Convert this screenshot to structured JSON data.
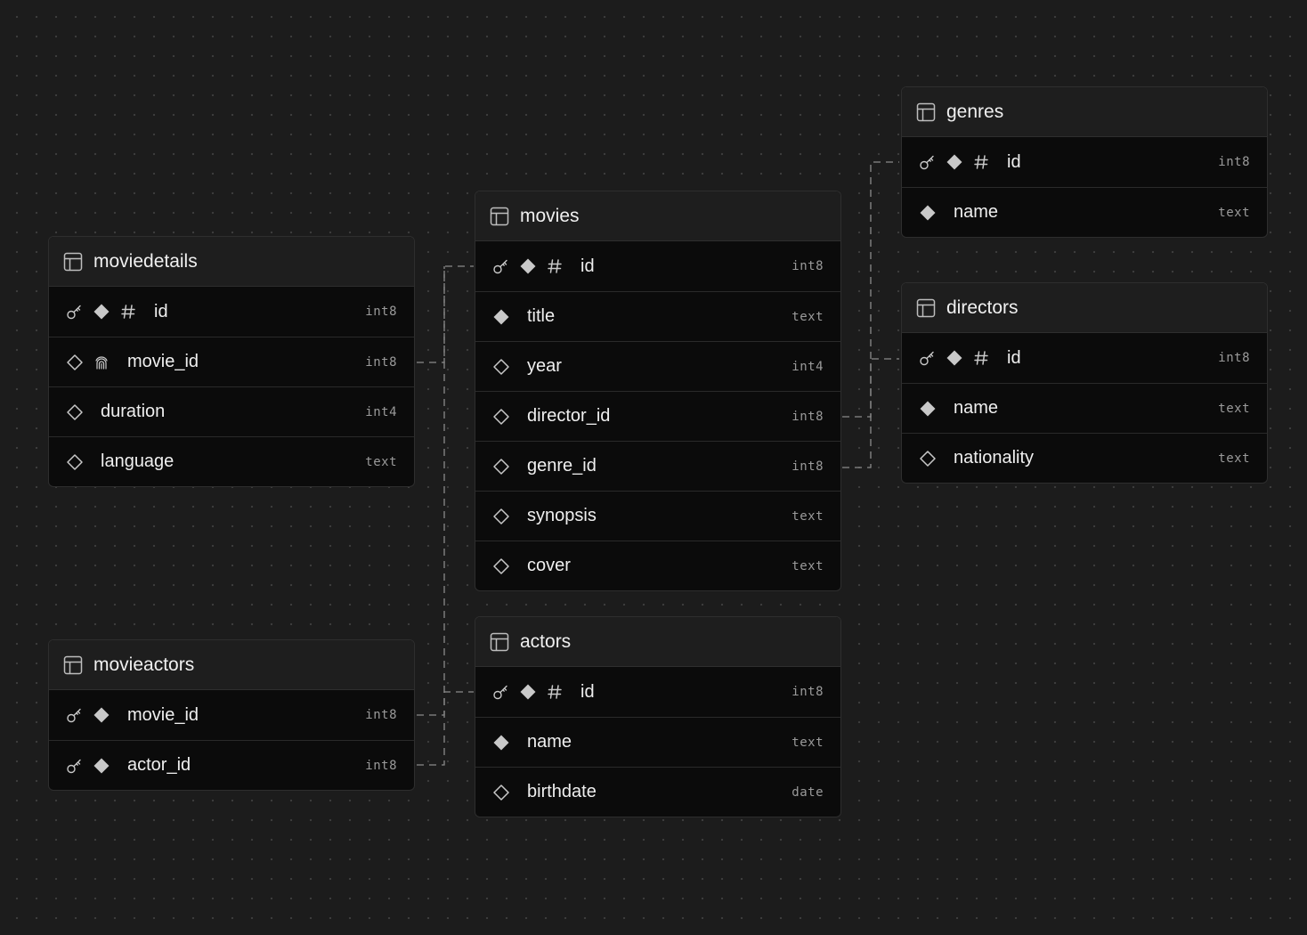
{
  "tables": {
    "moviedetails": {
      "name": "moviedetails",
      "columns": [
        {
          "name": "id",
          "type": "int8",
          "icons": [
            "key-icon",
            "filled-diamond-icon",
            "hash-icon"
          ]
        },
        {
          "name": "movie_id",
          "type": "int8",
          "icons": [
            "outline-diamond-icon",
            "fingerprint-icon"
          ]
        },
        {
          "name": "duration",
          "type": "int4",
          "icons": [
            "outline-diamond-icon"
          ]
        },
        {
          "name": "language",
          "type": "text",
          "icons": [
            "outline-diamond-icon"
          ]
        }
      ]
    },
    "movies": {
      "name": "movies",
      "columns": [
        {
          "name": "id",
          "type": "int8",
          "icons": [
            "key-icon",
            "filled-diamond-icon",
            "hash-icon"
          ]
        },
        {
          "name": "title",
          "type": "text",
          "icons": [
            "filled-diamond-icon"
          ]
        },
        {
          "name": "year",
          "type": "int4",
          "icons": [
            "outline-diamond-icon"
          ]
        },
        {
          "name": "director_id",
          "type": "int8",
          "icons": [
            "outline-diamond-icon"
          ]
        },
        {
          "name": "genre_id",
          "type": "int8",
          "icons": [
            "outline-diamond-icon"
          ]
        },
        {
          "name": "synopsis",
          "type": "text",
          "icons": [
            "outline-diamond-icon"
          ]
        },
        {
          "name": "cover",
          "type": "text",
          "icons": [
            "outline-diamond-icon"
          ]
        }
      ]
    },
    "genres": {
      "name": "genres",
      "columns": [
        {
          "name": "id",
          "type": "int8",
          "icons": [
            "key-icon",
            "filled-diamond-icon",
            "hash-icon"
          ]
        },
        {
          "name": "name",
          "type": "text",
          "icons": [
            "filled-diamond-icon"
          ]
        }
      ]
    },
    "directors": {
      "name": "directors",
      "columns": [
        {
          "name": "id",
          "type": "int8",
          "icons": [
            "key-icon",
            "filled-diamond-icon",
            "hash-icon"
          ]
        },
        {
          "name": "name",
          "type": "text",
          "icons": [
            "filled-diamond-icon"
          ]
        },
        {
          "name": "nationality",
          "type": "text",
          "icons": [
            "outline-diamond-icon"
          ]
        }
      ]
    },
    "movieactors": {
      "name": "movieactors",
      "columns": [
        {
          "name": "movie_id",
          "type": "int8",
          "icons": [
            "key-icon",
            "filled-diamond-icon"
          ]
        },
        {
          "name": "actor_id",
          "type": "int8",
          "icons": [
            "key-icon",
            "filled-diamond-icon"
          ]
        }
      ]
    },
    "actors": {
      "name": "actors",
      "columns": [
        {
          "name": "id",
          "type": "int8",
          "icons": [
            "key-icon",
            "filled-diamond-icon",
            "hash-icon"
          ]
        },
        {
          "name": "name",
          "type": "text",
          "icons": [
            "filled-diamond-icon"
          ]
        },
        {
          "name": "birthdate",
          "type": "date",
          "icons": [
            "outline-diamond-icon"
          ]
        }
      ]
    }
  },
  "relationships": [
    {
      "from": "moviedetails.movie_id",
      "to": "movies.id"
    },
    {
      "from": "movies.director_id",
      "to": "directors.id"
    },
    {
      "from": "movies.genre_id",
      "to": "genres.id"
    },
    {
      "from": "movieactors.movie_id",
      "to": "movies.id"
    },
    {
      "from": "movieactors.actor_id",
      "to": "actors.id"
    }
  ],
  "colors": {
    "canvas": "#1c1c1c",
    "table_header": "#1e1e1e",
    "table_body": "#0b0b0b",
    "connector": "#8a8a8a",
    "icon": "#c9c9c9"
  }
}
